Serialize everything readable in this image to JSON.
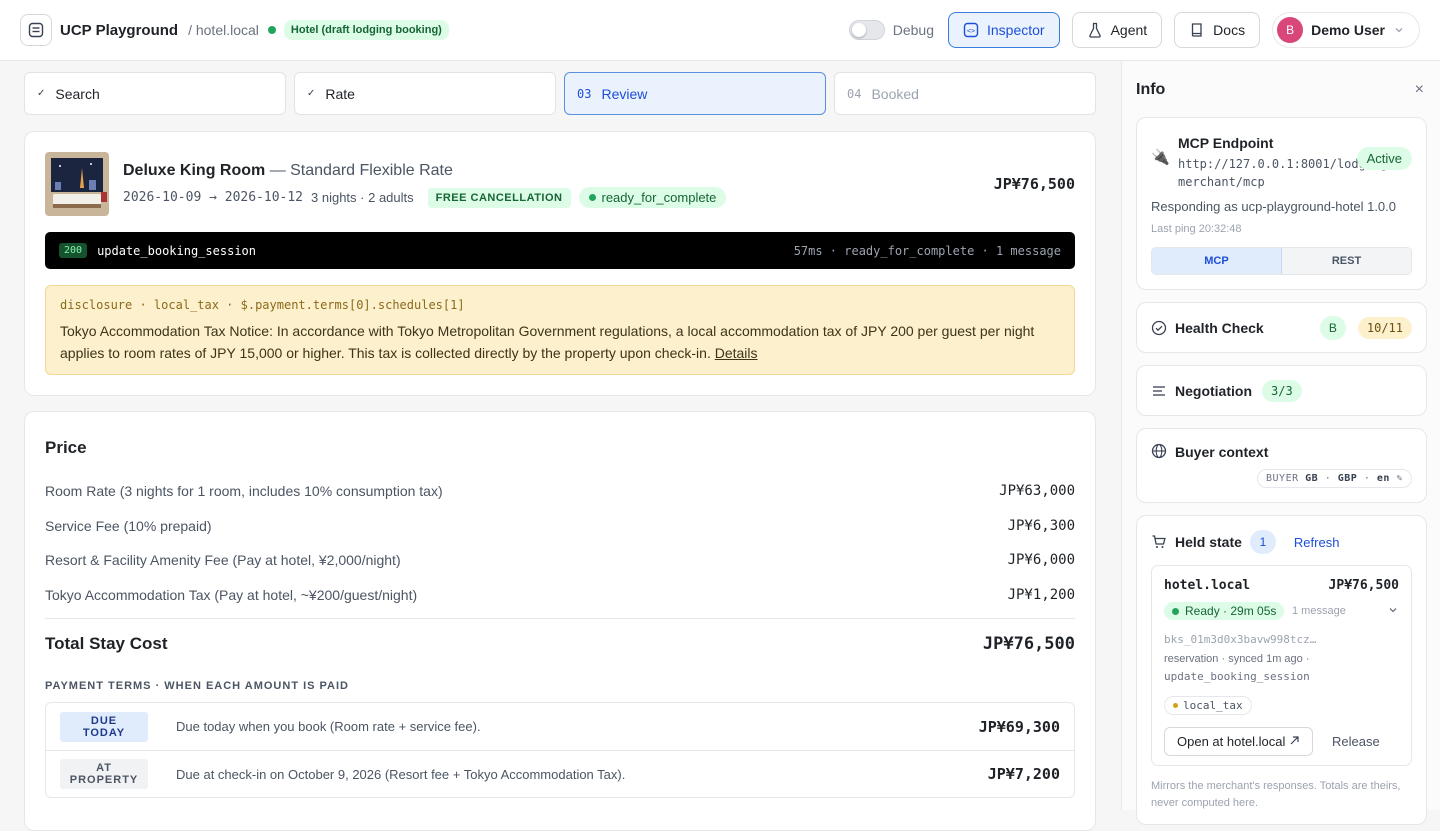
{
  "header": {
    "app_title": "UCP Playground",
    "crumb": "/ hotel.local",
    "badge": "Hotel (draft lodging booking)",
    "debug_label": "Debug",
    "inspector_label": "Inspector",
    "agent_label": "Agent",
    "docs_label": "Docs",
    "user_initial": "B",
    "user_name": "Demo User"
  },
  "steps": [
    {
      "num": "✓",
      "label": "Search",
      "state": "done"
    },
    {
      "num": "✓",
      "label": "Rate",
      "state": "done"
    },
    {
      "num": "03",
      "label": "Review",
      "state": "current"
    },
    {
      "num": "04",
      "label": "Booked",
      "state": "future"
    }
  ],
  "room": {
    "name": "Deluxe King Room",
    "rate": "— Standard Flexible Rate",
    "dates": "2026-10-09 → 2026-10-12",
    "guests": "3 nights · 2 adults",
    "cancellation": "FREE CANCELLATION",
    "status": "ready_for_complete",
    "price": "JP¥76,500"
  },
  "response": {
    "code": "200",
    "operation": "update_booking_session",
    "meta": "57ms · ready_for_complete · 1 message"
  },
  "notice": {
    "head": "disclosure · local_tax · $.payment.terms[0].schedules[1]",
    "text": "Tokyo Accommodation Tax Notice: In accordance with Tokyo Metropolitan Government regulations, a local accommodation tax of JPY 200 per guest per night applies to room rates of JPY 15,000 or higher. This tax is collected directly by the property upon check-in.",
    "link": "Details"
  },
  "price": {
    "title": "Price",
    "rows": [
      {
        "label": "Room Rate (3 nights for 1 room, includes 10% consumption tax)",
        "amount": "JP¥63,000"
      },
      {
        "label": "Service Fee (10% prepaid)",
        "amount": "JP¥6,300"
      },
      {
        "label": "Resort & Facility Amenity Fee (Pay at hotel, ¥2,000/night)",
        "amount": "JP¥6,000"
      },
      {
        "label": "Tokyo Accommodation Tax (Pay at hotel, ~¥200/guest/night)",
        "amount": "JP¥1,200"
      }
    ],
    "total_label": "Total Stay Cost",
    "total_amount": "JP¥76,500",
    "terms_head": "PAYMENT TERMS · WHEN EACH AMOUNT IS PAID",
    "terms": [
      {
        "badge": "DUE TODAY",
        "desc": "Due today when you book (Room rate + service fee).",
        "amount": "JP¥69,300"
      },
      {
        "badge": "AT PROPERTY",
        "desc": "Due at check-in on October 9, 2026 (Resort fee + Tokyo Accommodation Tax).",
        "amount": "JP¥7,200"
      }
    ]
  },
  "info": {
    "title": "Info",
    "close": "×",
    "mcp": {
      "title": "MCP Endpoint",
      "url": "http://127.0.0.1:8001/lodging-merchant/mcp",
      "status": "Active",
      "responding": "Responding as ucp-playground-hotel 1.0.0",
      "last_ping": "Last ping 20:32:48",
      "proto_mcp": "MCP",
      "proto_rest": "REST"
    },
    "health": {
      "title": "Health Check",
      "grade": "B",
      "score": "10/11"
    },
    "negotiation": {
      "title": "Negotiation",
      "score": "3/3"
    },
    "buyer": {
      "title": "Buyer context",
      "label": "BUYER",
      "country": "GB",
      "currency": "GBP",
      "lang": "en",
      "edit": "✎"
    },
    "held": {
      "title": "Held state",
      "count": "1",
      "refresh": "Refresh",
      "item": {
        "name": "hotel.local",
        "price": "JP¥76,500",
        "ready": "Ready · 29m 05s",
        "messages": "1 message",
        "id": "bks_01m3d0x3bavw998tcz…",
        "sync": "reservation · synced 1m ago ·",
        "op": "update_booking_session",
        "tax": "local_tax",
        "open": "Open at hotel.local",
        "release": "Release"
      },
      "note": "Mirrors the merchant's responses. Totals are theirs, never computed here."
    }
  }
}
